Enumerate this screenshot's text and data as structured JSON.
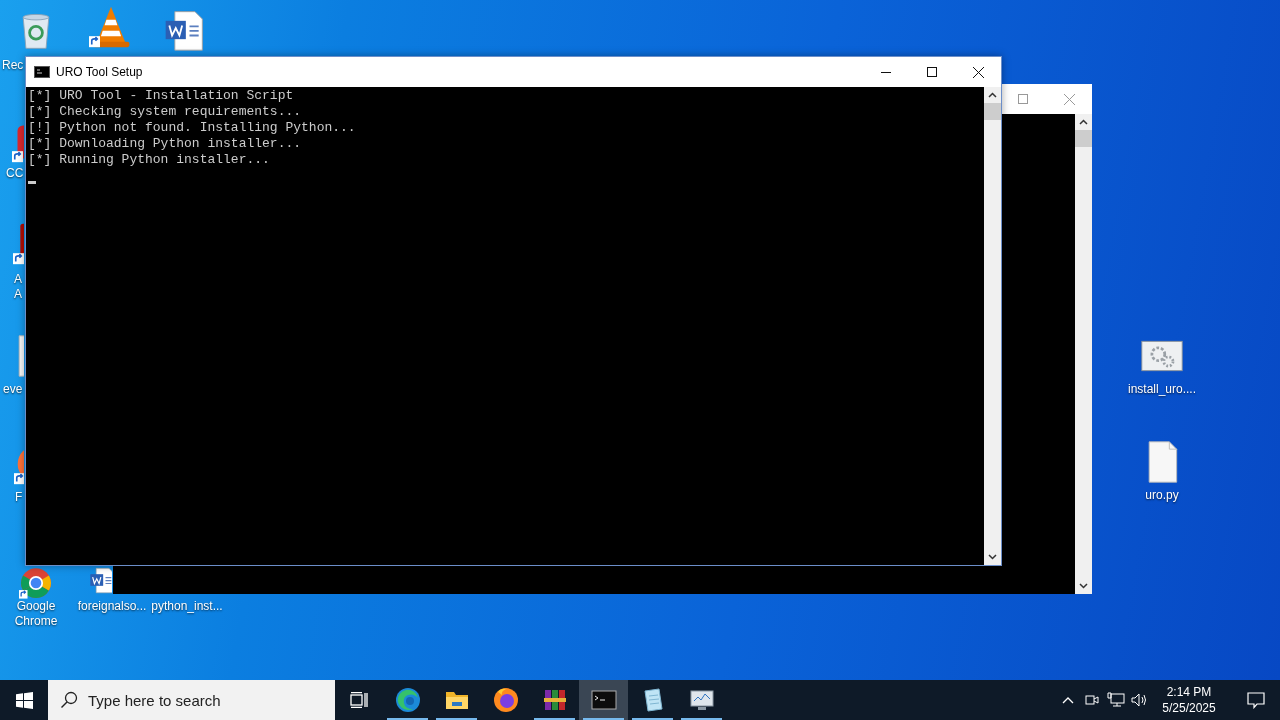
{
  "desktop": {
    "icons": [
      {
        "kind": "recycle-bin",
        "label": "Rec"
      },
      {
        "kind": "cone",
        "shortcut": true
      },
      {
        "kind": "word"
      },
      {
        "kind": "app",
        "label": "CC",
        "shortcut": true
      },
      {
        "kind": "pdf",
        "label": "A A",
        "shortcut": true
      },
      {
        "kind": "page",
        "label": "eve"
      },
      {
        "kind": "browser-fox",
        "label": "F",
        "shortcut": true
      },
      {
        "kind": "chrome",
        "label": "Google Chrome",
        "shortcut": true
      },
      {
        "kind": "word",
        "label": "foreignalso..."
      },
      {
        "label": "python_inst..."
      },
      {
        "kind": "settings-file",
        "label": "install_uro...."
      },
      {
        "kind": "page",
        "label": "uro.py"
      }
    ]
  },
  "console": {
    "title": "URO Tool Setup",
    "lines": [
      "[*] URO Tool - Installation Script",
      "[*] Checking system requirements...",
      "[!] Python not found. Installing Python...",
      "[*] Downloading Python installer...",
      "[*] Running Python installer..."
    ],
    "cursor": true
  },
  "taskbar": {
    "search": {
      "placeholder": "Type here to search"
    },
    "apps": [
      {
        "kind": "edge",
        "running": true,
        "selected": false
      },
      {
        "kind": "folder",
        "running": true,
        "selected": false
      },
      {
        "kind": "firefox",
        "running": false,
        "selected": false
      },
      {
        "kind": "archive",
        "running": true,
        "selected": false
      },
      {
        "kind": "terminal",
        "running": true,
        "selected": true
      },
      {
        "kind": "notepad",
        "running": true,
        "selected": false
      },
      {
        "kind": "monitor",
        "running": true,
        "selected": false
      }
    ],
    "clock": {
      "time": "2:14 PM",
      "date": "5/25/2025"
    }
  }
}
